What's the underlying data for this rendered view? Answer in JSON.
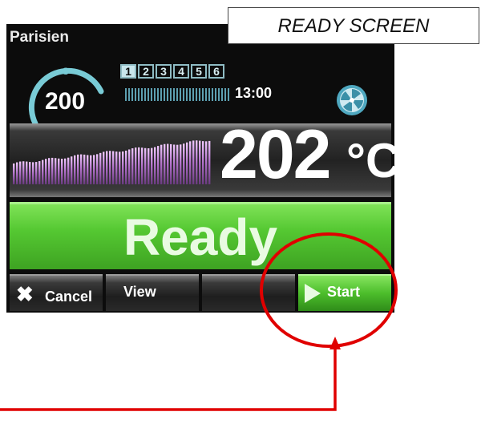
{
  "caption": "READY SCREEN",
  "device": {
    "recipe_name": "Parisien",
    "setpoint": {
      "unit": "oC",
      "value": "200"
    },
    "program_tabs": [
      "1",
      "2",
      "3",
      "4",
      "5",
      "6"
    ],
    "active_tab": "1",
    "timer": "13:00",
    "current_temp": {
      "value": "202",
      "unit": "°C"
    },
    "status": "Ready",
    "softkeys": {
      "cancel": "Cancel",
      "view": "View",
      "blank": "",
      "start": "Start"
    }
  },
  "colors": {
    "screen_bg": "#0c0c0c",
    "status_green": "#55c832",
    "accent_cyan": "#79cbd6",
    "graph_purple": "#c88ad6",
    "annotation_red": "#e00000"
  }
}
